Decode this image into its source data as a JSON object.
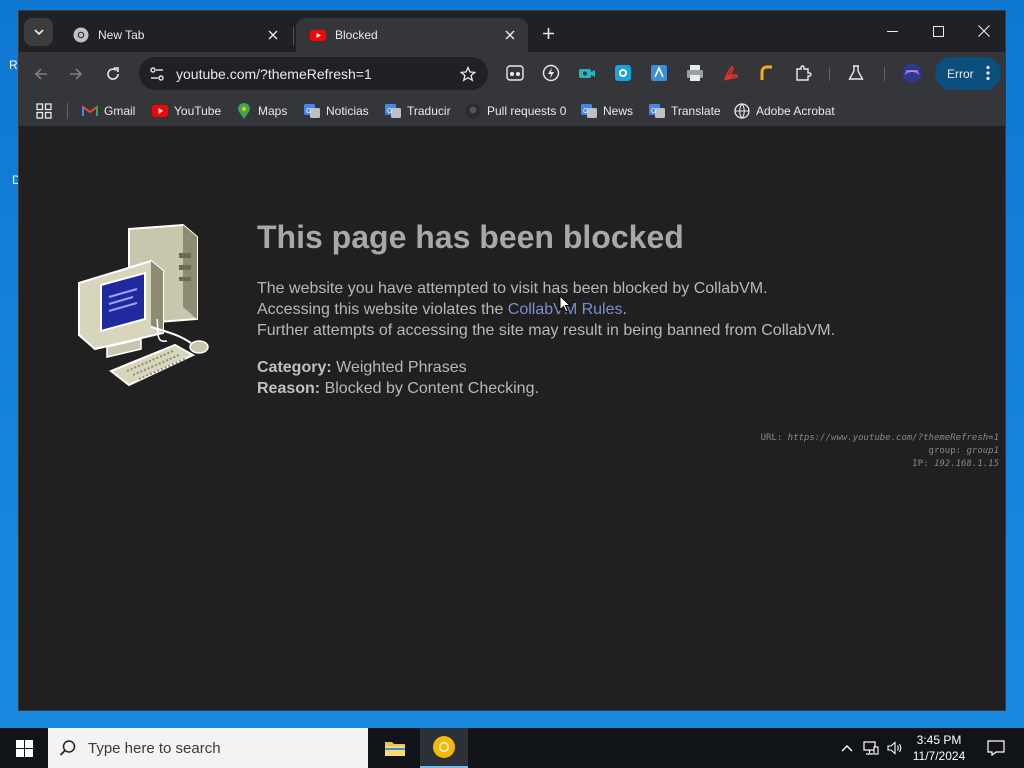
{
  "desktop": {
    "fragments": [
      "R",
      "",
      "D",
      ""
    ]
  },
  "tabs": [
    {
      "title": "New Tab",
      "icon": "chrome-icon",
      "active": false
    },
    {
      "title": "Blocked",
      "icon": "youtube-icon",
      "active": true
    }
  ],
  "toolbar": {
    "url": "youtube.com/?themeRefresh=1",
    "error_label": "Error"
  },
  "bookmarks": [
    {
      "label": "Gmail",
      "icon": "gmail-icon"
    },
    {
      "label": "YouTube",
      "icon": "youtube-icon"
    },
    {
      "label": "Maps",
      "icon": "maps-icon"
    },
    {
      "label": "Noticias",
      "icon": "google-translate-icon"
    },
    {
      "label": "Traducir",
      "icon": "google-translate-icon"
    },
    {
      "label": "Pull requests 0",
      "icon": "github-icon"
    },
    {
      "label": "News",
      "icon": "google-translate-icon"
    },
    {
      "label": "Translate",
      "icon": "google-translate-icon"
    },
    {
      "label": "Adobe Acrobat",
      "icon": "globe-icon"
    }
  ],
  "page": {
    "title": "This page has been blocked",
    "line1": "The website you have attempted to visit has been blocked by CollabVM.",
    "line2_prefix": "Accessing this website violates the ",
    "line2_link": "CollabVM Rules",
    "line2_suffix": ".",
    "line3": "Further attempts of accessing the site may result in being banned from CollabVM.",
    "category_label": "Category:",
    "category_value": "Weighted Phrases",
    "reason_label": "Reason:",
    "reason_value": "Blocked by Content Checking.",
    "url_label": "URL:",
    "url_value": "https://www.youtube.com/?themeRefresh=1",
    "group_label": "group:",
    "group_value": "group1",
    "ip_label": "IP:",
    "ip_value": "192.168.1.15"
  },
  "taskbar": {
    "search_placeholder": "Type here to search",
    "time": "3:45 PM",
    "date": "11/7/2024"
  },
  "colors": {
    "accent_link": "#7a8fcf",
    "error_pill": "#0b4f7d",
    "page_bg": "#202020"
  }
}
